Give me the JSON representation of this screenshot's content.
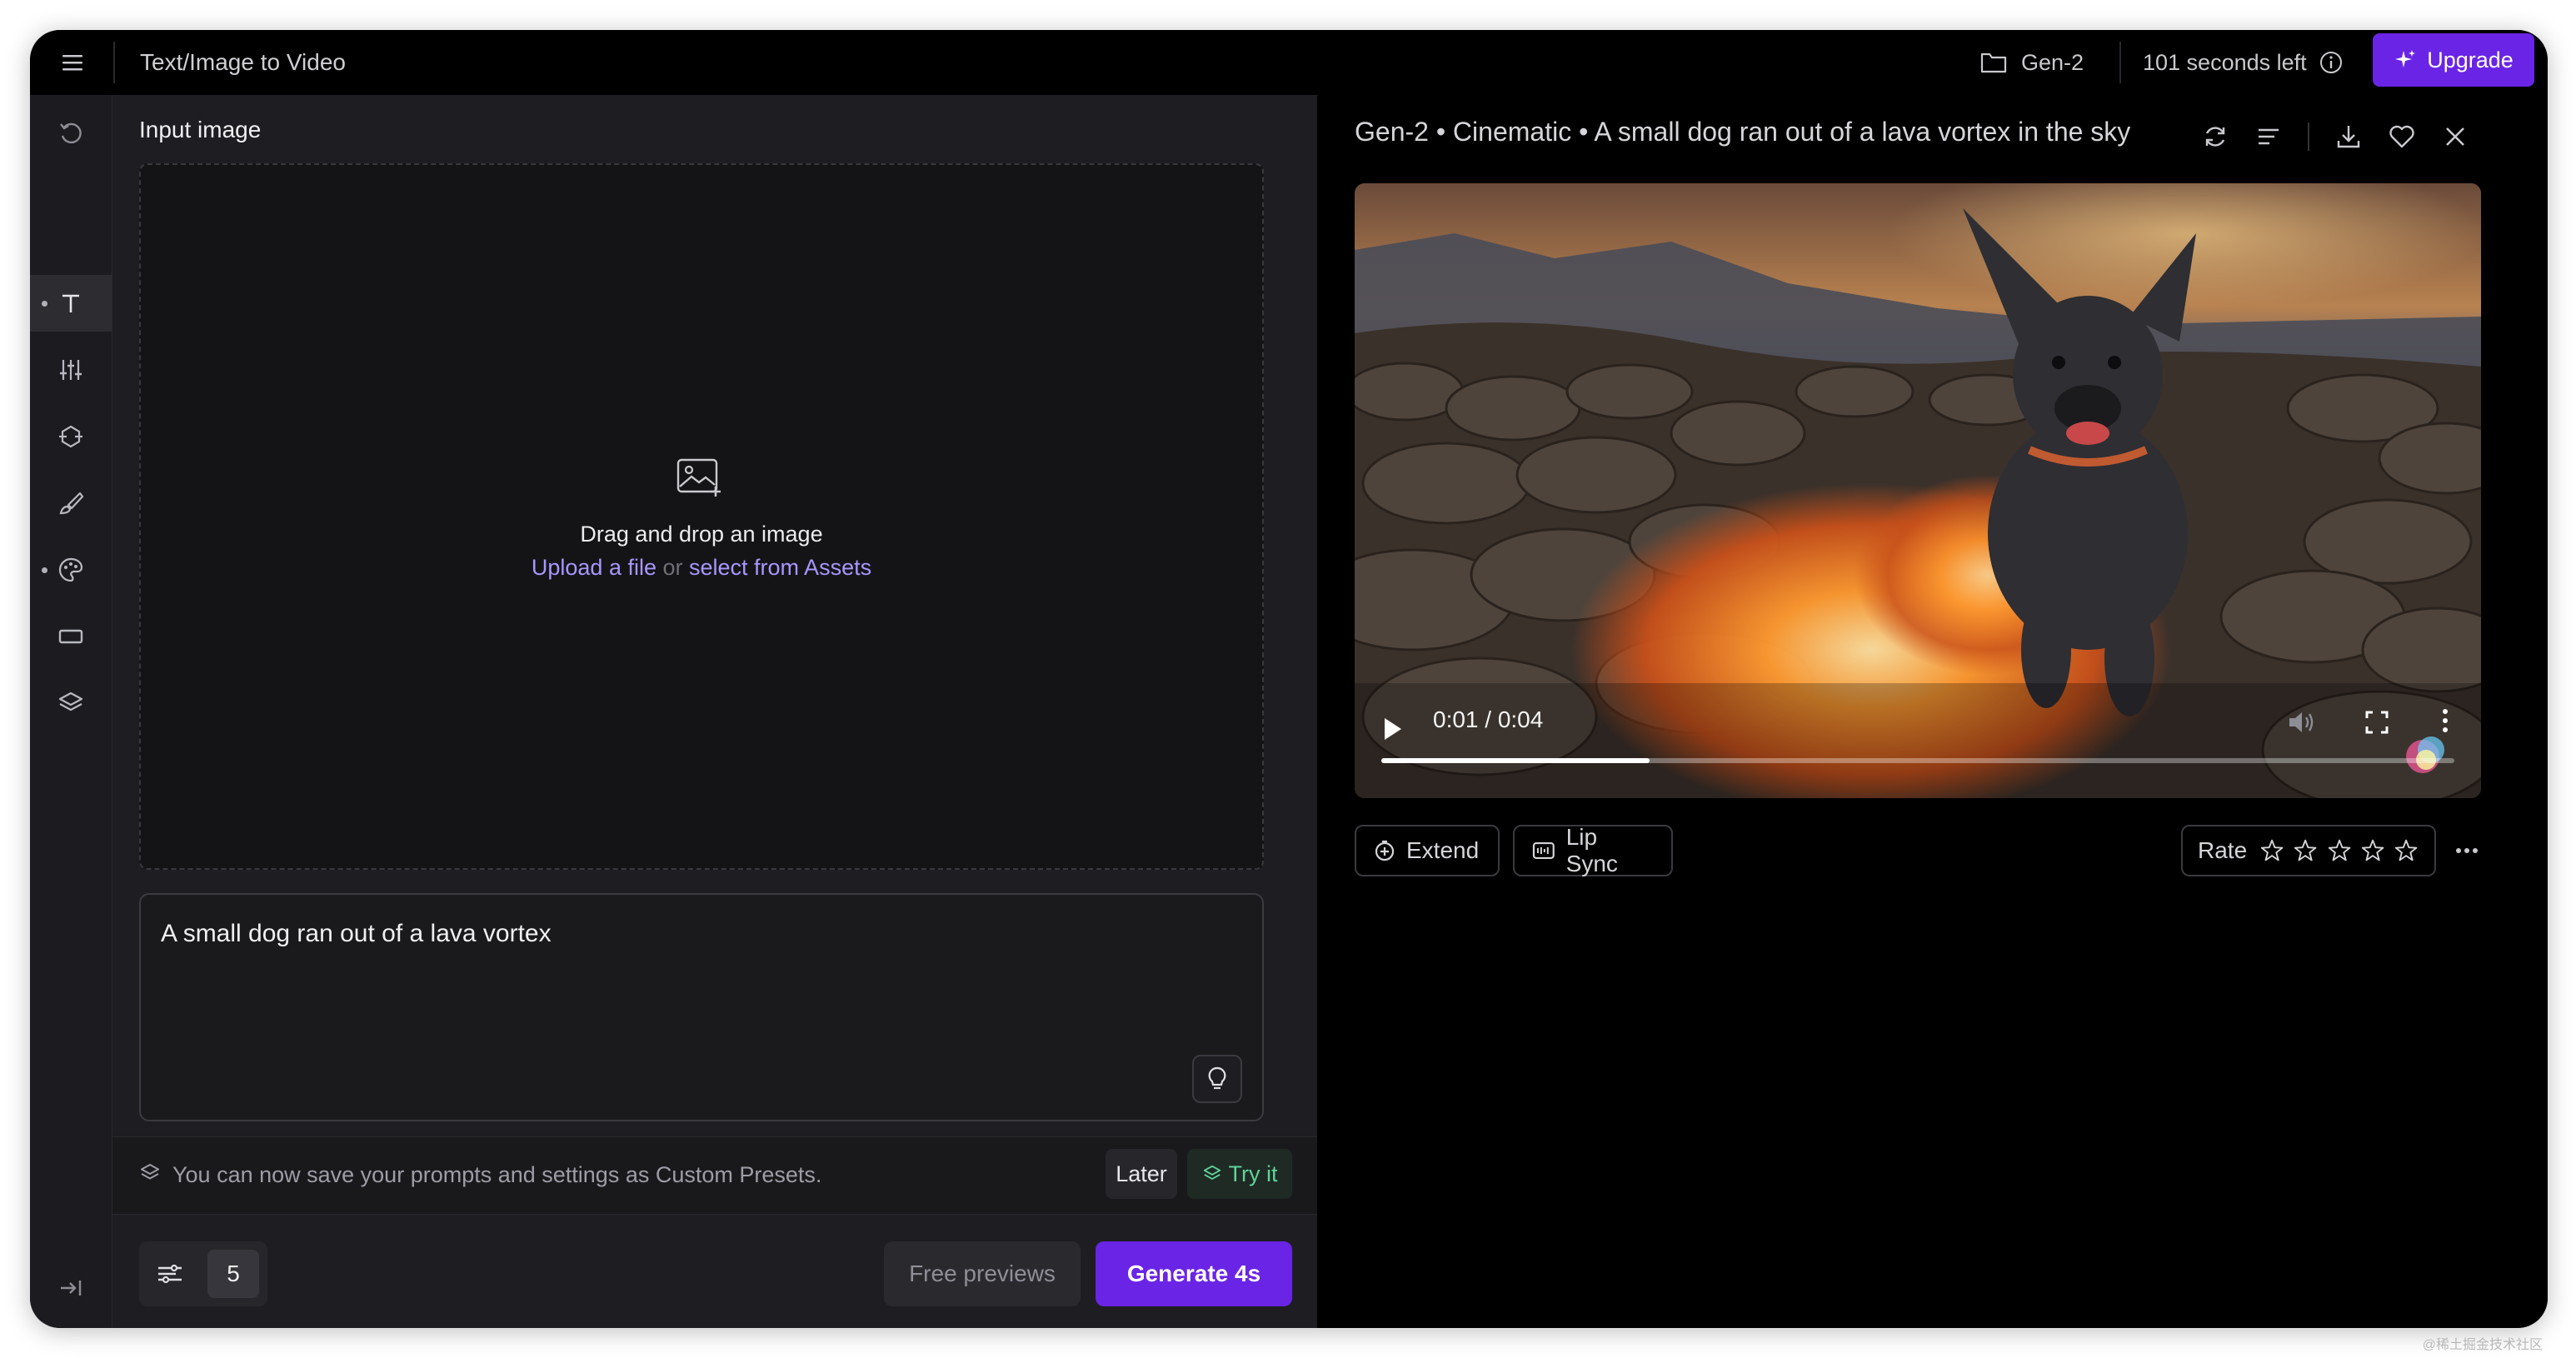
{
  "topbar": {
    "title": "Text/Image to Video",
    "project": "Gen-2",
    "seconds_left": "101 seconds left",
    "upgrade_label": "Upgrade"
  },
  "sidebar": {
    "items": [
      {
        "icon": "history-icon"
      },
      {
        "icon": "text-icon",
        "active": true
      },
      {
        "icon": "sliders-icon"
      },
      {
        "icon": "camera-motion-icon"
      },
      {
        "icon": "brush-icon"
      },
      {
        "icon": "palette-icon"
      },
      {
        "icon": "aspect-ratio-icon"
      },
      {
        "icon": "layers-icon"
      },
      {
        "icon": "collapse-icon"
      }
    ]
  },
  "left": {
    "input_label": "Input image",
    "dropzone": {
      "line1": "Drag and drop an image",
      "upload_link": "Upload a file",
      "or": " or ",
      "assets_link": "select from Assets"
    },
    "prompt": "A small dog ran out of a lava vortex",
    "notice": {
      "text": "You can now save your prompts and settings as Custom Presets.",
      "later": "Later",
      "try_it": "Try it"
    },
    "bottom": {
      "count": "5",
      "free_previews": "Free previews",
      "generate": "Generate 4s"
    }
  },
  "right": {
    "title": "Gen-2 • Cinematic • A small dog ran out of a lava vortex in the sky",
    "video": {
      "time": "0:01 / 0:04",
      "progress": 0.25
    },
    "extend": "Extend",
    "lip_sync": "Lip Sync",
    "rate": "Rate"
  },
  "colors": {
    "accent": "#6a24e6",
    "link": "#a996ff",
    "try_it": "#5fd39a"
  },
  "watermark": "@稀土掘金技术社区"
}
